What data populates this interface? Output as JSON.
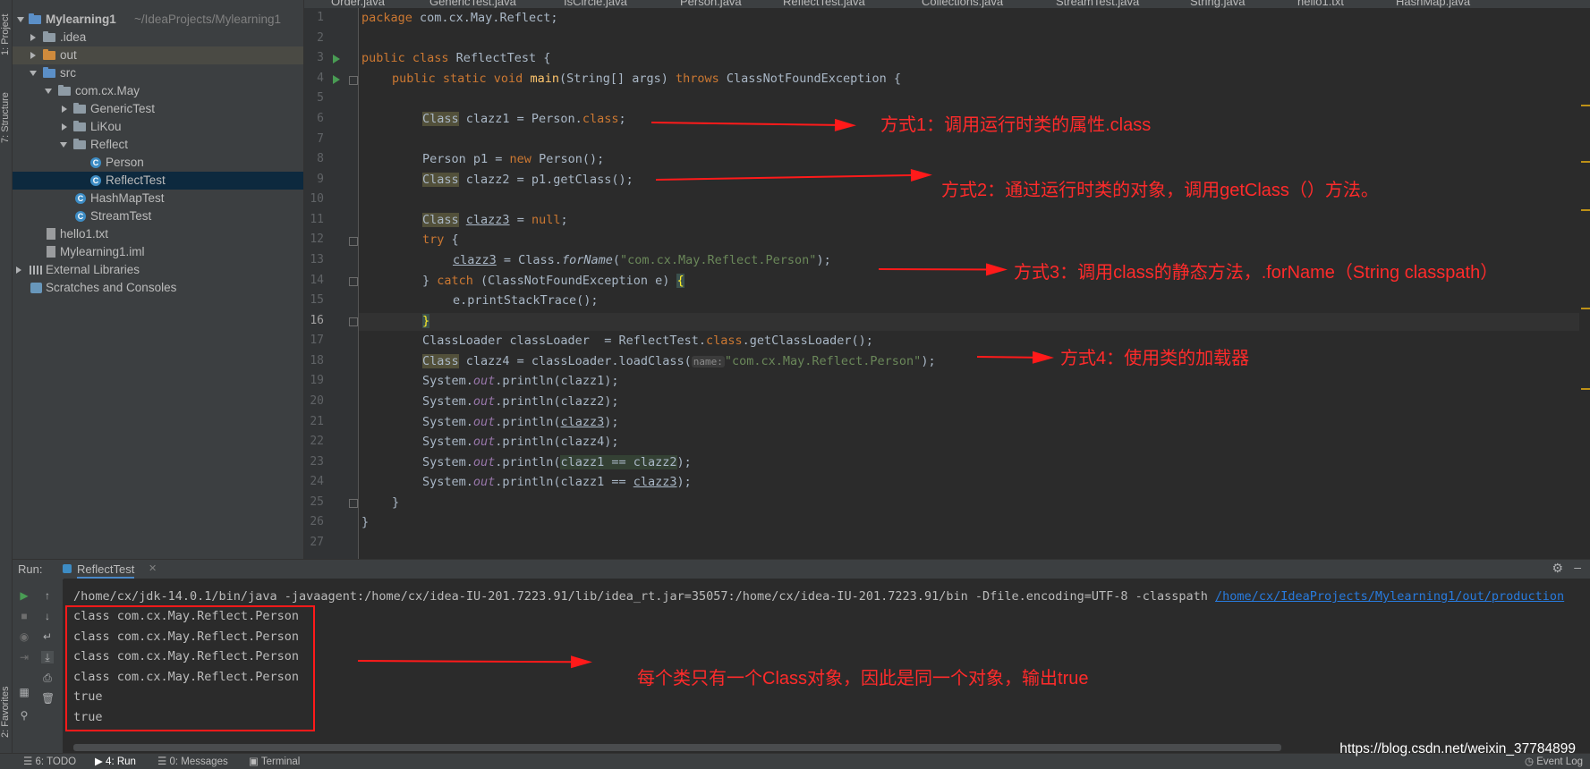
{
  "left_strip": {
    "project_tab": "1: Project",
    "structure_tab": "7: Structure",
    "favorites_tab": "2: Favorites"
  },
  "project_tree": [
    {
      "label": "Mylearning1",
      "suffix": "~/IdeaProjects/Mylearning1",
      "icon": "module-folder-icon",
      "state": "expanded"
    },
    {
      "label": ".idea",
      "icon": "folder-icon",
      "state": "collapsed"
    },
    {
      "label": "out",
      "icon": "excluded-folder-icon",
      "state": "collapsed"
    },
    {
      "label": "src",
      "icon": "source-folder-icon",
      "state": "expanded"
    },
    {
      "label": "com.cx.May",
      "icon": "package-icon",
      "state": "expanded"
    },
    {
      "label": "GenericTest",
      "icon": "package-icon",
      "state": "collapsed"
    },
    {
      "label": "LiKou",
      "icon": "package-icon",
      "state": "collapsed"
    },
    {
      "label": "Reflect",
      "icon": "package-icon",
      "state": "expanded"
    },
    {
      "label": "Person",
      "icon": "class-icon"
    },
    {
      "label": "ReflectTest",
      "icon": "class-icon",
      "selected": true
    },
    {
      "label": "HashMapTest",
      "icon": "class-icon"
    },
    {
      "label": "StreamTest",
      "icon": "class-icon"
    },
    {
      "label": "hello1.txt",
      "icon": "text-file-icon"
    },
    {
      "label": "Mylearning1.iml",
      "icon": "iml-file-icon"
    },
    {
      "label": "External Libraries",
      "icon": "library-icon",
      "state": "collapsed"
    },
    {
      "label": "Scratches and Consoles",
      "icon": "scratch-icon"
    }
  ],
  "editor_tabs": [
    "Order.java",
    "GenericTest.java",
    "IsCircle.java",
    "Person.java",
    "ReflectTest.java",
    "Collections.java",
    "StreamTest.java",
    "String.java",
    "hello1.txt",
    "HashMap.java"
  ],
  "active_tab": "ReflectTest.java",
  "code_lines": [
    "1",
    "2",
    "3",
    "4",
    "5",
    "6",
    "7",
    "8",
    "9",
    "10",
    "11",
    "12",
    "13",
    "14",
    "15",
    "16",
    "17",
    "18",
    "19",
    "20",
    "21",
    "22",
    "23",
    "24",
    "25",
    "26",
    "27"
  ],
  "code": {
    "l1_kw": "package",
    "l1_rest": " com.cx.May.Reflect;",
    "l3_kw": "public class",
    "l3_rest": " ReflectTest {",
    "l4_kw": "public static void",
    "l4_fn": "main",
    "l4_mid": "(String[] args) ",
    "l4_kw2": "throws",
    "l4_rest": " ClassNotFoundException {",
    "class": "Class",
    "l6_a": " clazz1 = Person.",
    "l6_kw": "class",
    "l6_b": ";",
    "l8_a": "Person p1 = ",
    "l8_kw": "new",
    "l8_b": " Person();",
    "l9_a": " clazz2 = p1.getClass();",
    "l11_a": " ",
    "l11_var": "clazz3",
    "l11_b": " = ",
    "l11_kw": "null",
    "l11_c": ";",
    "l12_kw": "try",
    "l12_b": " {",
    "l13_var": "clazz3",
    "l13_a": " = Class.",
    "l13_fn": "forName",
    "l13_b": "(",
    "l13_str": "\"com.cx.May.Reflect.Person\"",
    "l13_c": ");",
    "l14_a": "} ",
    "l14_kw": "catch",
    "l14_b": " (ClassNotFoundException e) ",
    "l14_brace": "{",
    "l15": "e.printStackTrace();",
    "l16_brace": "}",
    "l17_a": "ClassLoader classLoader  = ReflectTest.",
    "l17_kw": "class",
    "l17_b": ".getClassLoader();",
    "l18_a": " clazz4 = classLoader.loadClass(",
    "l18_hint": "name:",
    "l18_str": "\"com.cx.May.Reflect.Person\"",
    "l18_b": ");",
    "sys": "System.",
    "out": "out",
    "println": ".println(",
    "l19_arg": "clazz1",
    "l20_arg": "clazz2",
    "l21_arg": "clazz3",
    "l22_arg": "clazz4",
    "l23_arg": "clazz1 == clazz2",
    "l24_a": "clazz1 == ",
    "l24_b": "clazz3",
    "end": ");",
    "l25": "}",
    "l26": "}"
  },
  "annotations": {
    "a1": "方式1：调用运行时类的属性.class",
    "a2": "方式2：通过运行时类的对象，调用getClass（）方法。",
    "a3": "方式3：调用class的静态方法，.forName（String classpath）",
    "a4": "方式4：使用类的加载器",
    "a5": "每个类只有一个Class对象，因此是同一个对象，输出true"
  },
  "run_panel": {
    "label": "Run:",
    "tab": "ReflectTest",
    "command_prefix": "/home/cx/jdk-14.0.1/bin/java -javaagent:/home/cx/idea-IU-201.7223.91/lib/idea_rt.jar=35057:/home/cx/idea-IU-201.7223.91/bin -Dfile.encoding=UTF-8 -classpath ",
    "command_link": "/home/cx/IdeaProjects/Mylearning1/out/production",
    "output": [
      "class com.cx.May.Reflect.Person",
      "class com.cx.May.Reflect.Person",
      "class com.cx.May.Reflect.Person",
      "class com.cx.May.Reflect.Person",
      "true",
      "true"
    ]
  },
  "status_bar": {
    "todo": "6: TODO",
    "run": "4: Run",
    "messages": "0: Messages",
    "terminal": "Terminal",
    "event_log": "Event Log"
  },
  "watermark": "https://blog.csdn.net/weixin_37784899",
  "colors": {
    "annotation": "#FF2B2B",
    "keyword": "#CC7832",
    "string": "#6A8759",
    "field": "#9876AA"
  }
}
